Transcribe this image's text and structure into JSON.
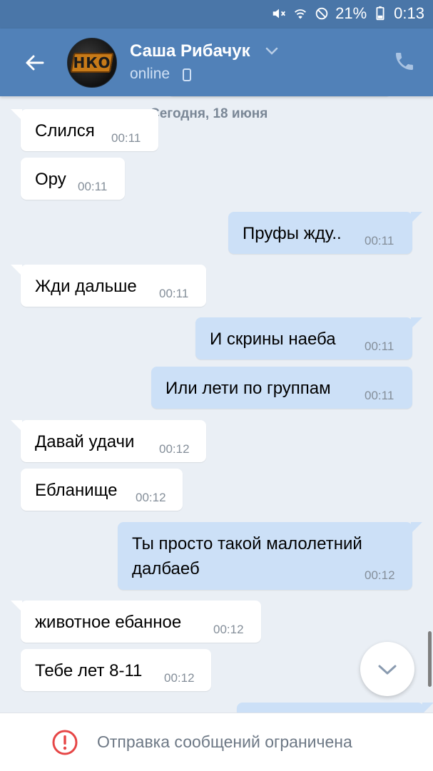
{
  "status_bar": {
    "battery": "21%",
    "time": "0:13"
  },
  "header": {
    "contact_name": "Саша Рибачук",
    "status": "online",
    "avatar_text": "НКО"
  },
  "chat": {
    "date": "Сегодня, 18 июня",
    "messages": [
      {
        "dir": "in",
        "text": "Слился",
        "time": "00:11"
      },
      {
        "dir": "in",
        "text": "Ору",
        "time": "00:11"
      },
      {
        "dir": "out",
        "text": "Пруфы жду..",
        "time": "00:11"
      },
      {
        "dir": "in",
        "text": "Жди дальше",
        "time": "00:11"
      },
      {
        "dir": "out",
        "text": "И скрины наеба",
        "time": "00:11"
      },
      {
        "dir": "out",
        "text": "Или лети по группам",
        "time": "00:11"
      },
      {
        "dir": "in",
        "text": "Давай удачи",
        "time": "00:12"
      },
      {
        "dir": "in",
        "text": "Ебланище",
        "time": "00:12"
      },
      {
        "dir": "out",
        "text_line1": "Ты просто такой малолетний",
        "text_line2": "далбаеб",
        "time": "00:12"
      },
      {
        "dir": "in",
        "text": "животное ебанное",
        "time": "00:12"
      },
      {
        "dir": "in",
        "text": "Тебе лет 8-11",
        "time": "00:12"
      }
    ]
  },
  "footer": {
    "restriction_text": "Отправка сообщений ограничена"
  },
  "colors": {
    "header": "#5181b8",
    "statusbar": "#4a76a8",
    "bubble_out": "#cce0f7",
    "bubble_in": "#ffffff",
    "chat_bg": "#eaeff5",
    "alert": "#e64646"
  }
}
